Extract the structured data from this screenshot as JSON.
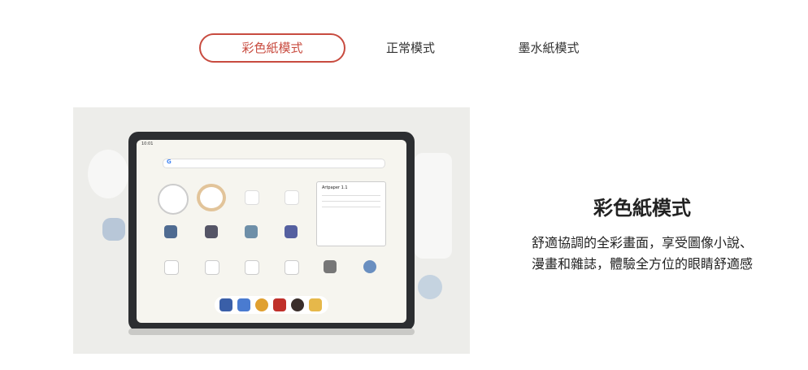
{
  "tabs": [
    {
      "label": "彩色紙模式",
      "active": true
    },
    {
      "label": "正常模式",
      "active": false
    },
    {
      "label": "墨水紙模式",
      "active": false
    }
  ],
  "accent_color": "#c84b3f",
  "content": {
    "title": "彩色紙模式",
    "description_line1": "舒適協調的全彩畫面，享受圖像小說、",
    "description_line2": "漫畫和雜誌，體驗全方位的眼睛舒適感"
  },
  "device_screen": {
    "status_time": "10:01",
    "search_logo": "G",
    "note_title": "Artpaper 1.1"
  }
}
